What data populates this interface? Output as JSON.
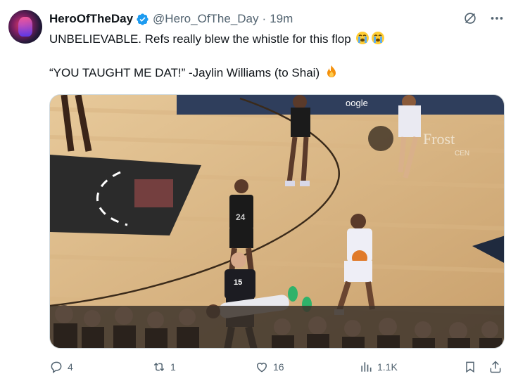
{
  "tweet": {
    "display_name": "HeroOfTheDay",
    "handle": "@Hero_OfThe_Day",
    "separator": "·",
    "time": "19m",
    "line1": "UNBELIEVABLE. Refs really blew the whistle for this flop",
    "line2": "“YOU TAUGHT ME DAT!” -Jaylin Williams (to Shai)",
    "line1_emojis": [
      "loudly-crying-face",
      "loudly-crying-face"
    ],
    "line2_emoji": "fire",
    "media": {
      "scoreboard_text": "oogle",
      "court_logo_text": "Frost",
      "court_logo_subtext": "CEN",
      "jersey_number_spurs": "24",
      "jersey_number_ref": "15"
    }
  },
  "actions": {
    "replies": "4",
    "reposts": "1",
    "likes": "16",
    "views": "1.1K"
  },
  "colors": {
    "verified_blue": "#1d9bf0",
    "secondary_text": "#536471",
    "primary_text": "#0f1419"
  },
  "icons": [
    "grok-icon",
    "more-icon",
    "reply-icon",
    "repost-icon",
    "like-icon",
    "views-icon",
    "bookmark-icon",
    "share-icon"
  ]
}
